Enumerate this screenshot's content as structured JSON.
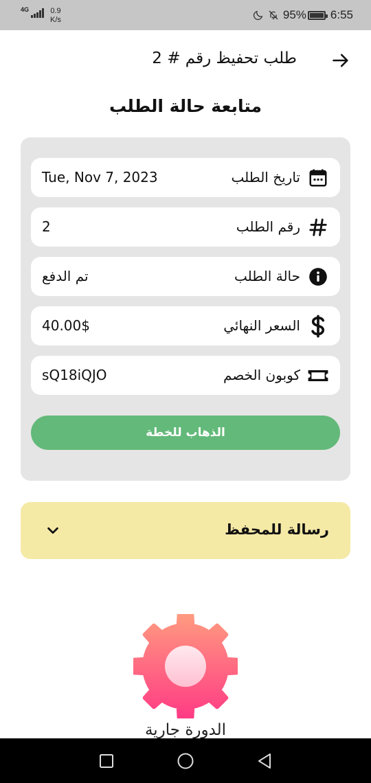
{
  "status_bar": {
    "network": "4G",
    "speed_value": "0.9",
    "speed_unit": "K/s",
    "battery": "95%",
    "time": "6:55"
  },
  "header": {
    "title": "طلب تحفيظ رقم # 2",
    "back_icon": "arrow-right-icon"
  },
  "page_title": "متابعة حالة الطلب",
  "details": [
    {
      "icon": "calendar-icon",
      "label": "تاريخ الطلب",
      "value": "Tue, Nov 7, 2023"
    },
    {
      "icon": "hash-icon",
      "label": "رقم الطلب",
      "value": "2"
    },
    {
      "icon": "info-icon",
      "label": "حالة الطلب",
      "value": "تم الدفع"
    },
    {
      "icon": "dollar-icon",
      "label": "السعر النهائي",
      "value": "40.00$"
    },
    {
      "icon": "ticket-icon",
      "label": "كوبون الخصم",
      "value": "sQ18iQJO"
    }
  ],
  "plan_button": "الذهاب للخطة",
  "wallet": {
    "title": "رسالة للمحفظ",
    "chevron_icon": "chevron-down-icon"
  },
  "cycle": {
    "icon": "gear-icon",
    "caption": "الدورة جارية"
  },
  "colors": {
    "accent_green": "#63b979",
    "wallet_bg": "#f5e9a6",
    "card_bg": "#e5e5e5",
    "gear_top": "#ff9a80",
    "gear_bottom": "#ff3c84"
  }
}
